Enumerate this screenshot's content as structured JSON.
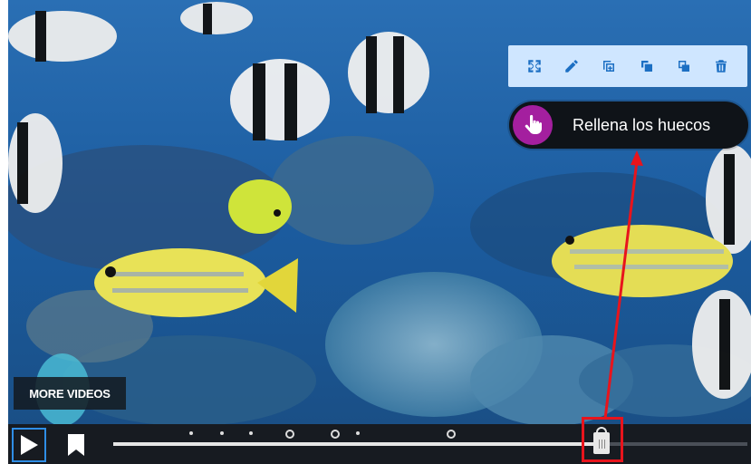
{
  "toolbar": {
    "buttons": [
      {
        "name": "expand",
        "icon": "expand-icon"
      },
      {
        "name": "edit",
        "icon": "pencil-icon"
      },
      {
        "name": "duplicate",
        "icon": "copy-plus-icon"
      },
      {
        "name": "bring-front",
        "icon": "bring-front-icon"
      },
      {
        "name": "send-back",
        "icon": "send-back-icon"
      },
      {
        "name": "delete",
        "icon": "trash-icon"
      }
    ]
  },
  "interaction": {
    "label": "Rellena los huecos",
    "icon": "hand-pointer-icon",
    "icon_color": "#a41f9f"
  },
  "overlay": {
    "more_videos": "MORE VIDEOS"
  },
  "player": {
    "play_icon": "play-icon",
    "bookmark_icon": "bookmark-icon",
    "progress_fraction": 0.76,
    "accent": "#2f8ee6"
  },
  "annotation": {
    "color": "#e8141c"
  }
}
